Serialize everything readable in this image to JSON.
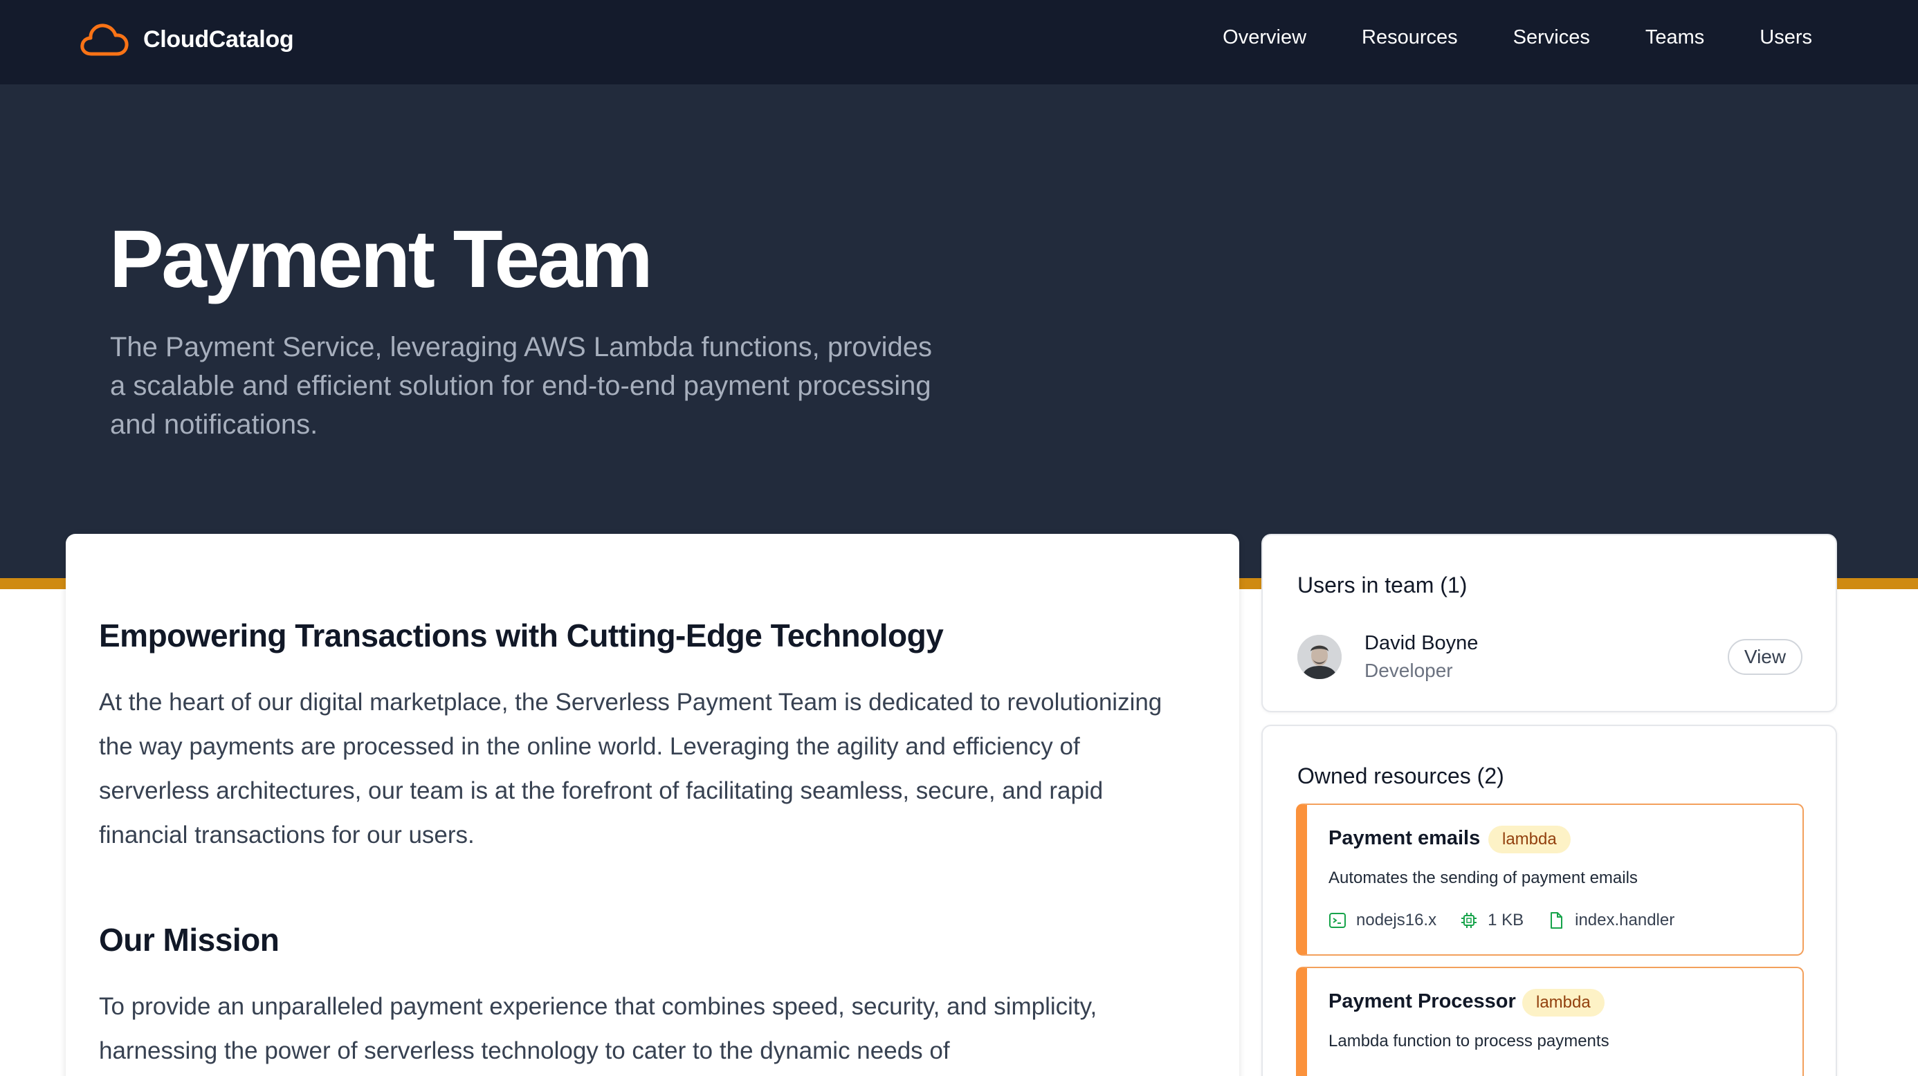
{
  "app": {
    "brand": "CloudCatalog"
  },
  "nav": {
    "items": [
      "Overview",
      "Resources",
      "Services",
      "Teams",
      "Users"
    ]
  },
  "hero": {
    "title": "Payment Team",
    "subtitle": "The Payment Service, leveraging AWS Lambda functions, provides a scalable and efficient solution for end-to-end payment processing and notifications."
  },
  "main": {
    "heading1": "Empowering Transactions with Cutting-Edge Technology",
    "para1": "At the heart of our digital marketplace, the Serverless Payment Team is dedicated to revolutionizing the way payments are processed in the online world. Leveraging the agility and efficiency of serverless architectures, our team is at the forefront of facilitating seamless, secure, and rapid financial transactions for our users.",
    "heading2": "Our Mission",
    "para2": "To provide an unparalleled payment experience that combines speed, security, and simplicity, harnessing the power of serverless technology to cater to the dynamic needs of"
  },
  "users_panel": {
    "title": "Users in team (1)",
    "users": [
      {
        "name": "David Boyne",
        "role": "Developer",
        "action": "View"
      }
    ]
  },
  "resources_panel": {
    "title": "Owned resources (2)",
    "resources": [
      {
        "name": "Payment emails",
        "badge": "lambda",
        "description": "Automates the sending of payment emails",
        "runtime": "nodejs16.x",
        "size": "1 KB",
        "handler": "index.handler"
      },
      {
        "name": "Payment Processor",
        "badge": "lambda",
        "description": "Lambda function to process payments"
      }
    ]
  },
  "colors": {
    "topbar": "#141b2c",
    "hero": "#222b3c",
    "accent": "#cf8a12",
    "brand_orange": "#f97316",
    "resource_border": "#fb923c",
    "badge_bg": "#fdf2c6"
  },
  "icons": [
    "cloud-icon",
    "terminal-icon",
    "chip-icon",
    "file-icon"
  ]
}
